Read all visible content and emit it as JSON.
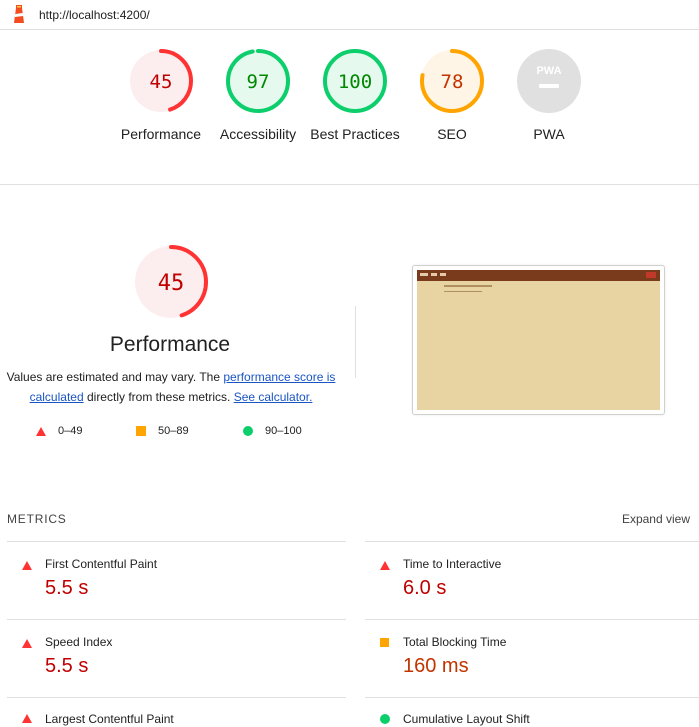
{
  "topbar": {
    "url": "http://localhost:4200/",
    "logo_icon": "lighthouse-icon"
  },
  "gauges": [
    {
      "score": "45",
      "label": "Performance",
      "rating": "fail",
      "fraction": 0.45
    },
    {
      "score": "97",
      "label": "Accessibility",
      "rating": "pass",
      "fraction": 0.97
    },
    {
      "score": "100",
      "label": "Best Practices",
      "rating": "pass",
      "fraction": 1.0
    },
    {
      "score": "78",
      "label": "SEO",
      "rating": "average",
      "fraction": 0.78
    },
    {
      "score": "PWA",
      "label": "PWA",
      "rating": "pwa",
      "fraction": 0
    }
  ],
  "colors": {
    "fail": "#ff3333",
    "fail_bg": "#fceeee",
    "fail_text": "#c00000",
    "pass": "#0cce6b",
    "pass_bg": "#e6f9ee",
    "pass_text": "#008800",
    "average": "#ffa400",
    "average_bg": "#fff5e6",
    "average_text": "#c33300",
    "pwa_bg": "#e0e0e0"
  },
  "performance": {
    "score": "45",
    "fraction": 0.45,
    "title": "Performance",
    "desc_prefix": "Values are estimated and may vary. The ",
    "desc_link1": "performance score is calculated",
    "desc_middle": " directly from these metrics. ",
    "desc_link2": "See calculator."
  },
  "legend": [
    {
      "range": "0–49",
      "icon": "triangle-icon"
    },
    {
      "range": "50–89",
      "icon": "square-icon"
    },
    {
      "range": "90–100",
      "icon": "circle-icon"
    }
  ],
  "metrics": {
    "heading": "METRICS",
    "expand_label": "Expand view",
    "items": [
      {
        "name": "First Contentful Paint",
        "value": "5.5 s",
        "rating": "fail"
      },
      {
        "name": "Time to Interactive",
        "value": "6.0 s",
        "rating": "fail"
      },
      {
        "name": "Speed Index",
        "value": "5.5 s",
        "rating": "fail"
      },
      {
        "name": "Total Blocking Time",
        "value": "160 ms",
        "rating": "average"
      },
      {
        "name": "Largest Contentful Paint",
        "value": "",
        "rating": "fail"
      },
      {
        "name": "Cumulative Layout Shift",
        "value": "",
        "rating": "pass"
      }
    ]
  }
}
